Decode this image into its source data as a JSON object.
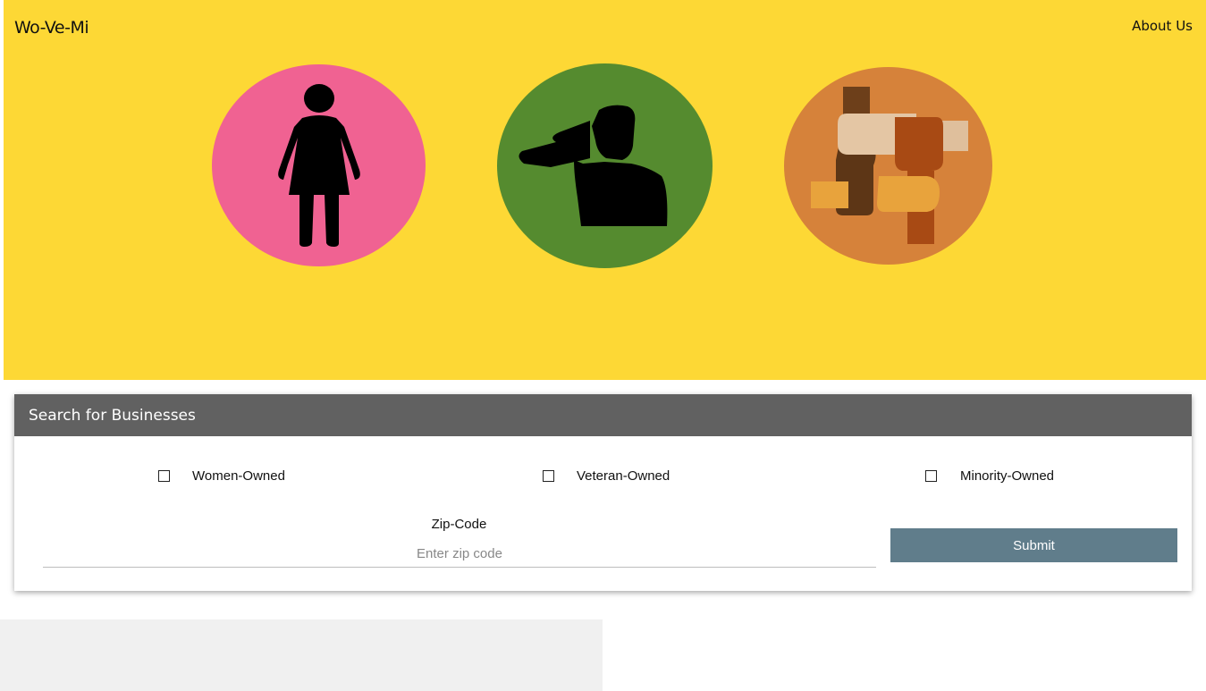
{
  "header": {
    "brand": "Wo-Ve-Mi",
    "about_link": "About Us",
    "background_color": "#fdd835"
  },
  "hero_icons": [
    {
      "name": "woman-icon",
      "color": "#f06292"
    },
    {
      "name": "saluting-soldier-icon",
      "color": "#558b2f"
    },
    {
      "name": "diverse-hands-icon",
      "color": "#d6823a"
    }
  ],
  "search": {
    "title": "Search for Businesses",
    "checkboxes": [
      {
        "label": "Women-Owned",
        "checked": false
      },
      {
        "label": "Veteran-Owned",
        "checked": false
      },
      {
        "label": "Minority-Owned",
        "checked": false
      }
    ],
    "zip_label": "Zip-Code",
    "zip_placeholder": "Enter zip code",
    "zip_value": "",
    "submit_label": "Submit",
    "submit_color": "#607d8b",
    "header_color": "#616161"
  }
}
